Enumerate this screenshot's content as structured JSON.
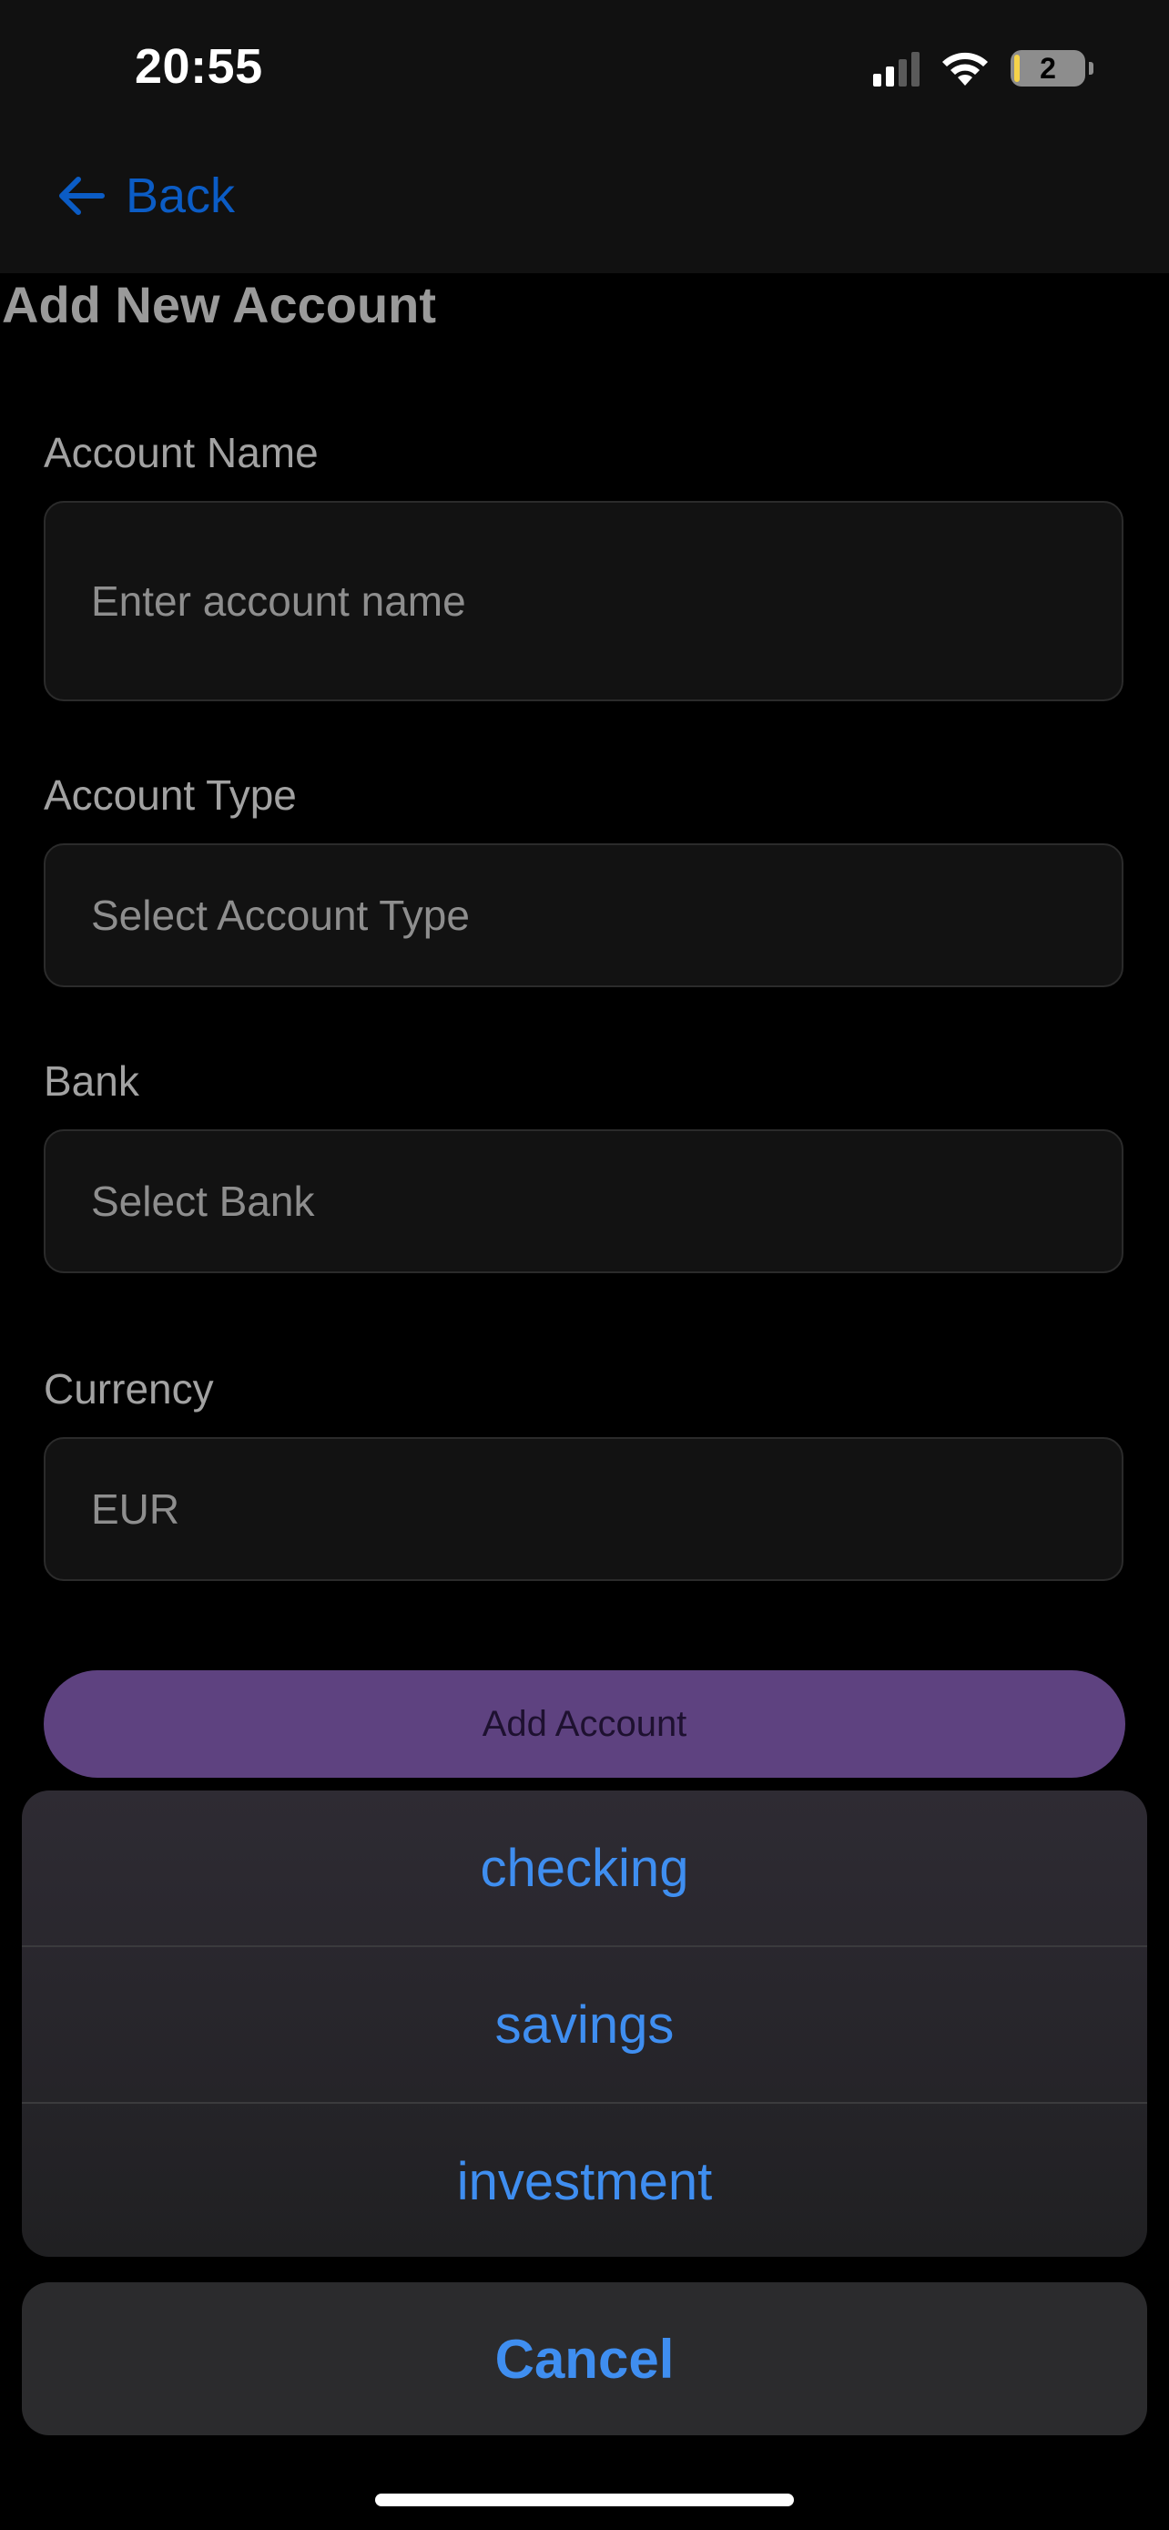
{
  "status_bar": {
    "time": "20:55",
    "battery_level": "2",
    "icons": [
      "cellular-signal-icon",
      "wifi-icon",
      "battery-icon"
    ]
  },
  "nav": {
    "back_label": "Back",
    "back_icon": "arrow-left-icon"
  },
  "form": {
    "title": "Add New Account",
    "account_name": {
      "label": "Account Name",
      "placeholder": "Enter account name"
    },
    "account_type": {
      "label": "Account Type",
      "value": "Select Account Type"
    },
    "bank": {
      "label": "Bank",
      "value": "Select Bank"
    },
    "currency": {
      "label": "Currency",
      "value": "EUR"
    },
    "submit_label": "Add Account"
  },
  "action_sheet": {
    "options": [
      {
        "label": "checking"
      },
      {
        "label": "savings"
      },
      {
        "label": "investment"
      }
    ],
    "cancel_label": "Cancel"
  },
  "colors": {
    "accent_blue": "#3f8ef0",
    "back_blue": "#0b5cc5",
    "button_purple": "#5e4280",
    "background": "#000000"
  }
}
